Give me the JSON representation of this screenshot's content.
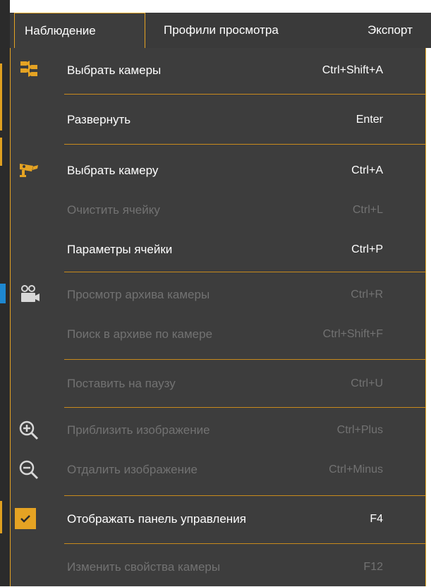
{
  "menubar": {
    "items": [
      {
        "label": "Наблюдение"
      },
      {
        "label": "Профили просмотра"
      },
      {
        "label": "Экспорт"
      }
    ]
  },
  "menu": {
    "items": [
      {
        "label": "Выбрать камеры",
        "shortcut": "Ctrl+Shift+A",
        "enabled": true,
        "icon": "cameras-select-icon"
      },
      {
        "label": "Развернуть",
        "shortcut": "Enter",
        "enabled": true
      },
      {
        "label": "Выбрать камеру",
        "shortcut": "Ctrl+A",
        "enabled": true,
        "icon": "camera-select-icon"
      },
      {
        "label": "Очистить ячейку",
        "shortcut": "Ctrl+L",
        "enabled": false
      },
      {
        "label": "Параметры ячейки",
        "shortcut": "Ctrl+P",
        "enabled": true
      },
      {
        "label": "Просмотр архива камеры",
        "shortcut": "Ctrl+R",
        "enabled": false,
        "icon": "video-camera-icon"
      },
      {
        "label": "Поиск в архиве по камере",
        "shortcut": "Ctrl+Shift+F",
        "enabled": false
      },
      {
        "label": "Поставить на паузу",
        "shortcut": "Ctrl+U",
        "enabled": false
      },
      {
        "label": "Приблизить изображение",
        "shortcut": "Ctrl+Plus",
        "enabled": false,
        "icon": "zoom-in-icon"
      },
      {
        "label": "Отдалить изображение",
        "shortcut": "Ctrl+Minus",
        "enabled": false,
        "icon": "zoom-out-icon"
      },
      {
        "label": "Отображать панель управления",
        "shortcut": "F4",
        "enabled": true,
        "checked": true,
        "icon": "check-icon"
      },
      {
        "label": "Изменить свойства камеры",
        "shortcut": "F12",
        "enabled": false
      }
    ]
  },
  "colors": {
    "accent": "#e5a323",
    "menu_bg": "#3d3d3d",
    "text": "#ffffff",
    "disabled_text": "#727272"
  }
}
